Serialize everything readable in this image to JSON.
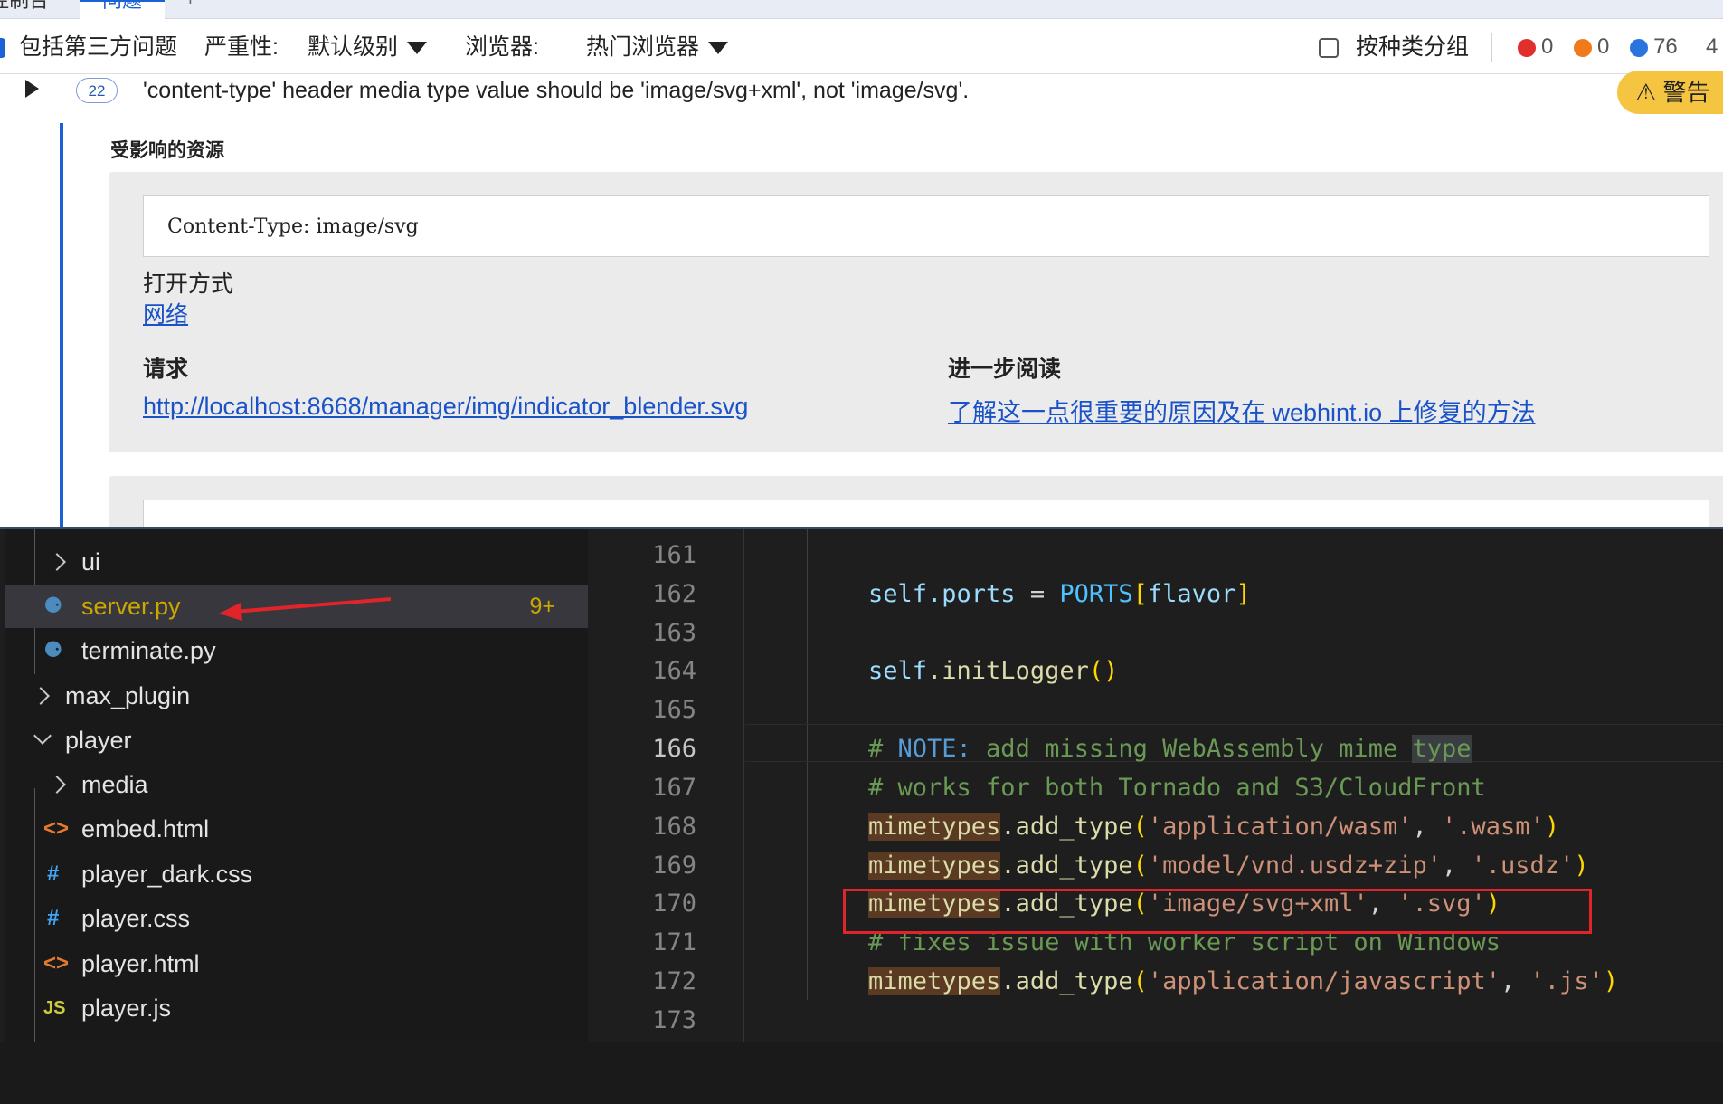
{
  "devtools": {
    "tabs": [
      {
        "label": "控制台"
      },
      {
        "label": "问题"
      },
      {
        "label": "+"
      }
    ],
    "toolbar": {
      "include_third_party": "包括第三方问题",
      "severity_label": "严重性:",
      "severity_value": "默认级别",
      "browser_label": "浏览器:",
      "browser_value": "热门浏览器",
      "group_by_kind": "按种类分组",
      "error_count": "0",
      "warning_count": "0",
      "info_count": "76",
      "extra_count": "4"
    },
    "issue": {
      "count": "22",
      "message": "'content-type' header media type value should be 'image/svg+xml', not 'image/svg'.",
      "badge": "⚠ 警告"
    },
    "resources": {
      "title": "受影响的资源",
      "header_value": "Content-Type: image/svg",
      "open_with_label": "打开方式",
      "open_with_link": "网络",
      "request_label": "请求",
      "request_url": "http://localhost:8668/manager/img/indicator_blender.svg",
      "further_reading_label": "进一步阅读",
      "further_reading_link": "了解这一点很重要的原因及在 webhint.io 上修复的方法"
    }
  },
  "explorer": {
    "items": [
      {
        "name": "ui"
      },
      {
        "name": "server.py",
        "badge": "9+"
      },
      {
        "name": "terminate.py"
      },
      {
        "name": "max_plugin"
      },
      {
        "name": "player"
      },
      {
        "name": "media"
      },
      {
        "name": "embed.html"
      },
      {
        "name": "player_dark.css"
      },
      {
        "name": "player.css"
      },
      {
        "name": "player.html"
      },
      {
        "name": "player.js"
      }
    ]
  },
  "editor": {
    "line_numbers": [
      "161",
      "162",
      "163",
      "164",
      "165",
      "166",
      "167",
      "168",
      "169",
      "170",
      "171",
      "172",
      "173"
    ],
    "lines": {
      "l162": {
        "self": "self",
        "ports": ".ports",
        "eq": " = ",
        "const": "PORTS",
        "lb": "[",
        "arg": "flavor",
        "rb": "]"
      },
      "l164": {
        "self": "self",
        "fn": ".initLogger",
        "paren": "()"
      },
      "l166": {
        "hash": "# ",
        "note": "NOTE:",
        "rest": " add missing WebAssembly mime ",
        "type": "type"
      },
      "l167": {
        "text": "# works for both Tornado and S3/CloudFront"
      },
      "l168": {
        "obj": "mimetypes",
        "fn": ".add_type",
        "lp": "(",
        "a1": "'application/wasm'",
        "comma": ", ",
        "a2": "'.wasm'",
        "rp": ")"
      },
      "l169": {
        "obj": "mimetypes",
        "fn": ".add_type",
        "lp": "(",
        "a1": "'model/vnd.usdz+zip'",
        "comma": ", ",
        "a2": "'.usdz'",
        "rp": ")"
      },
      "l170": {
        "obj": "mimetypes",
        "fn": ".add_type",
        "lp": "(",
        "a1": "'image/svg+xml'",
        "comma": ", ",
        "a2": "'.svg'",
        "rp": ")"
      },
      "l171": {
        "text": "# fixes issue with worker script on Windows"
      },
      "l172": {
        "obj": "mimetypes",
        "fn": ".add_type",
        "lp": "(",
        "a1": "'application/javascript'",
        "comma": ", ",
        "a2": "'.js'",
        "rp": ")"
      }
    }
  },
  "colors": {
    "accent_blue": "#1a62d6",
    "warning_yellow": "#f5c542",
    "annotation_red": "#e0242a",
    "badge_gold": "#cca700"
  }
}
